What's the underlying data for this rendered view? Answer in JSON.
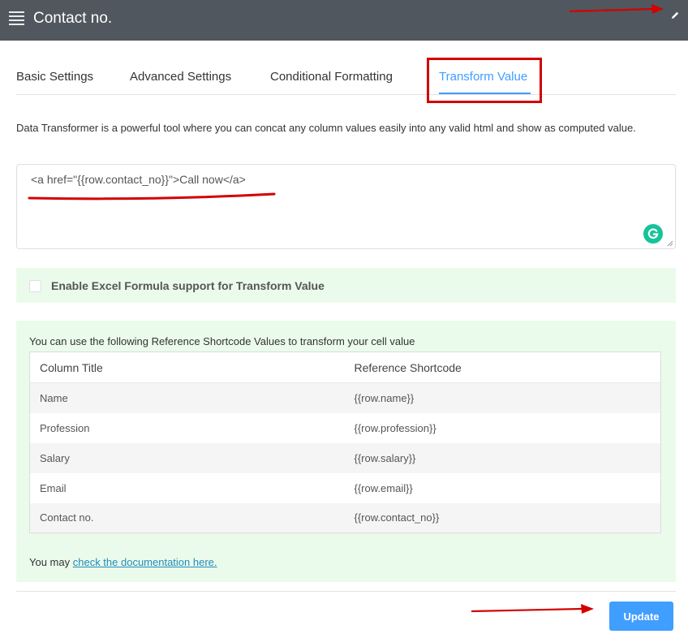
{
  "header": {
    "title": "Contact no.",
    "menu_icon": "hamburger-menu-icon",
    "edit_icon": "pencil-icon"
  },
  "tabs": [
    {
      "label": "Basic Settings",
      "active": false
    },
    {
      "label": "Advanced Settings",
      "active": false
    },
    {
      "label": "Conditional Formatting",
      "active": false
    },
    {
      "label": "Transform Value",
      "active": true
    }
  ],
  "description": "Data Transformer is a powerful tool where you can concat any column values easily into any valid html and show as computed value.",
  "editor": {
    "value": "<a href=\"{{row.contact_no}}\">Call now</a>"
  },
  "excel": {
    "label": "Enable Excel Formula support for Transform Value",
    "checked": false
  },
  "reference": {
    "intro": "You can use the following Reference Shortcode Values to transform your cell value",
    "headers": {
      "title": "Column Title",
      "shortcode": "Reference Shortcode"
    },
    "rows": [
      {
        "title": "Name",
        "shortcode": "{{row.name}}"
      },
      {
        "title": "Profession",
        "shortcode": "{{row.profession}}"
      },
      {
        "title": "Salary",
        "shortcode": "{{row.salary}}"
      },
      {
        "title": "Email",
        "shortcode": "{{row.email}}"
      },
      {
        "title": "Contact no.",
        "shortcode": "{{row.contact_no}}"
      }
    ],
    "footer_prefix": "You may ",
    "footer_link": "check the documentation here."
  },
  "actions": {
    "update_label": "Update"
  },
  "colors": {
    "header_bg": "#50575e",
    "accent": "#409eff",
    "green_panel": "#ebfbeb",
    "annotation_red": "#d40000"
  }
}
